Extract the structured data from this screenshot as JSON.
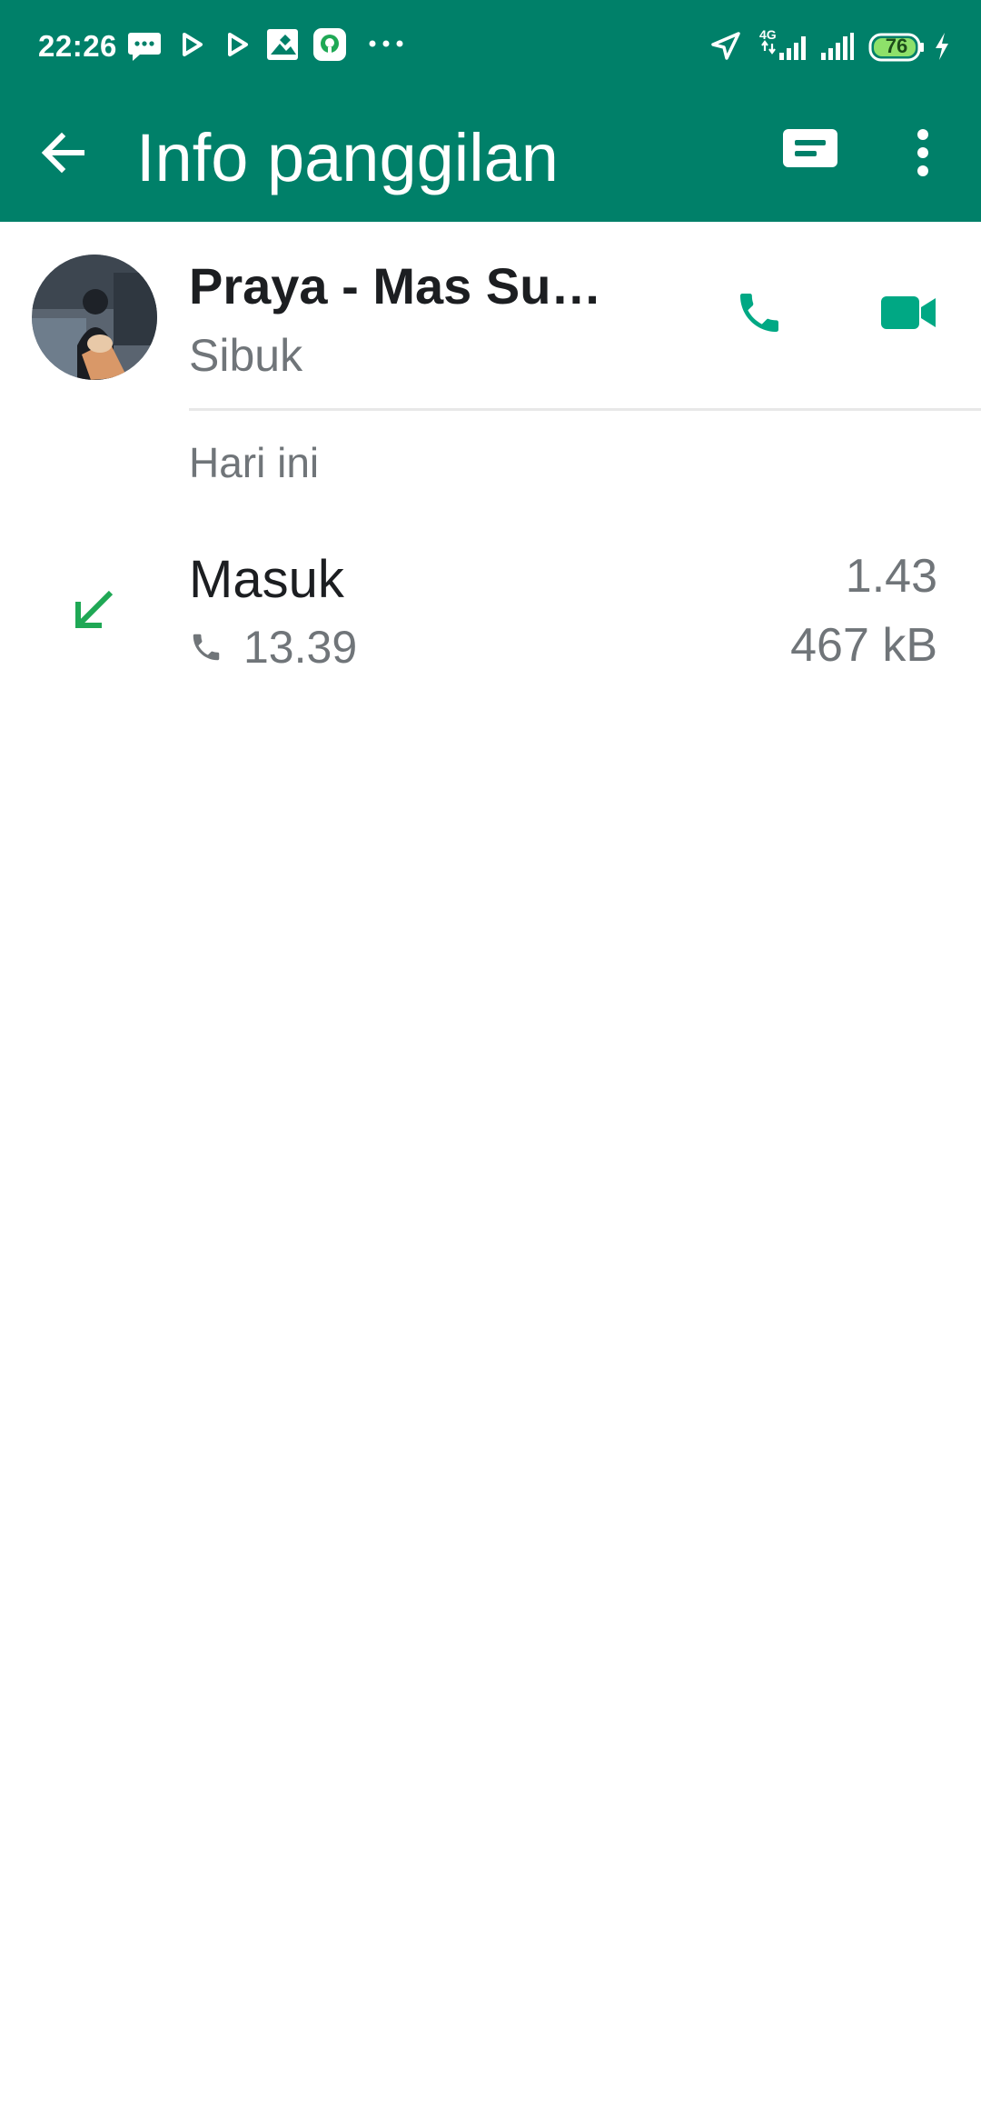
{
  "status_bar": {
    "time": "22:26",
    "network_label": "4G",
    "battery_level": "76",
    "icons": [
      "message-icon",
      "play-icon",
      "play-icon",
      "photo-icon",
      "app-icon",
      "more-dots-icon",
      "location-arrow-icon",
      "signal-icon",
      "signal-icon",
      "battery-icon",
      "charging-icon"
    ]
  },
  "app_bar": {
    "title": "Info panggilan",
    "icons": [
      "back-arrow-icon",
      "message-icon",
      "more-vert-icon"
    ]
  },
  "contact": {
    "name": "Praya - Mas Su…",
    "status": "Sibuk",
    "icons": [
      "phone-icon",
      "video-icon"
    ]
  },
  "calls": {
    "section_label": "Hari ini",
    "items": [
      {
        "type": "Masuk",
        "time": "13.39",
        "duration": "1.43",
        "size": "467 kB",
        "direction_icon": "incoming-arrow-icon"
      }
    ]
  },
  "colors": {
    "header": "#008069",
    "accent": "#00a884",
    "incoming": "#1fa855",
    "text_primary": "#1c1e21",
    "text_secondary": "#707579"
  }
}
